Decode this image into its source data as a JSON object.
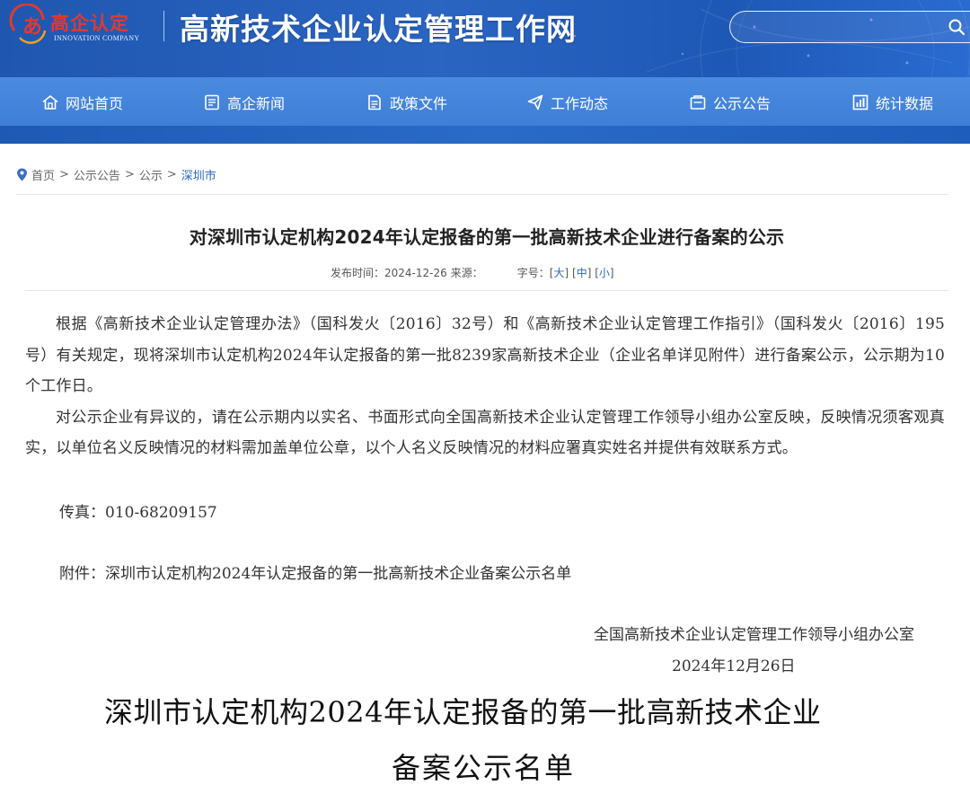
{
  "header": {
    "logo_cn": "高企认定",
    "logo_en": "INNOVATION COMPANY",
    "site_title": "高新技术企业认定管理工作网",
    "search": {
      "placeholder": ""
    }
  },
  "nav": {
    "items": [
      {
        "label": "网站首页",
        "icon": "home-icon"
      },
      {
        "label": "高企新闻",
        "icon": "news-icon"
      },
      {
        "label": "政策文件",
        "icon": "document-icon"
      },
      {
        "label": "工作动态",
        "icon": "paper-plane-icon"
      },
      {
        "label": "公示公告",
        "icon": "notice-icon"
      },
      {
        "label": "统计数据",
        "icon": "chart-icon"
      }
    ]
  },
  "breadcrumb": {
    "items": [
      "首页",
      "公示公告",
      "公示",
      "深圳市"
    ],
    "separator": ">"
  },
  "article": {
    "title": "对深圳市认定机构2024年认定报备的第一批高新技术企业进行备案的公示",
    "meta": {
      "publish_label": "发布时间：",
      "publish_date": "2024-12-26",
      "source_label": "来源：",
      "font_label": "字号：",
      "font_large": "大",
      "font_medium": "中",
      "font_small": "小"
    },
    "paragraphs": [
      "根据《高新技术企业认定管理办法》（国科发火〔2016〕32号）和《高新技术企业认定管理工作指引》（国科发火〔2016〕195号）有关规定，现将深圳市认定机构2024年认定报备的第一批8239家高新技术企业（企业名单详见附件）进行备案公示，公示期为10个工作日。",
      "对公示企业有异议的，请在公示期内以实名、书面形式向全国高新技术企业认定管理工作领导小组办公室反映，反映情况须客观真实，以单位名义反映情况的材料需加盖单位公章，以个人名义反映情况的材料应署真实姓名并提供有效联系方式。"
    ],
    "fax": "传真：010-68209157",
    "attachment": "附件：深圳市认定机构2024年认定报备的第一批高新技术企业备案公示名单",
    "signature_org": "全国高新技术企业认定管理工作领导小组办公室",
    "signature_date": "2024年12月26日",
    "list_title_line1": "深圳市认定机构2024年认定报备的第一批高新技术企业",
    "list_title_line2": "备案公示名单"
  },
  "colors": {
    "banner": "#2a65c2",
    "nav": "#4a8be0",
    "logo_red": "#e23a2c",
    "link_blue": "#2a6ac8"
  }
}
